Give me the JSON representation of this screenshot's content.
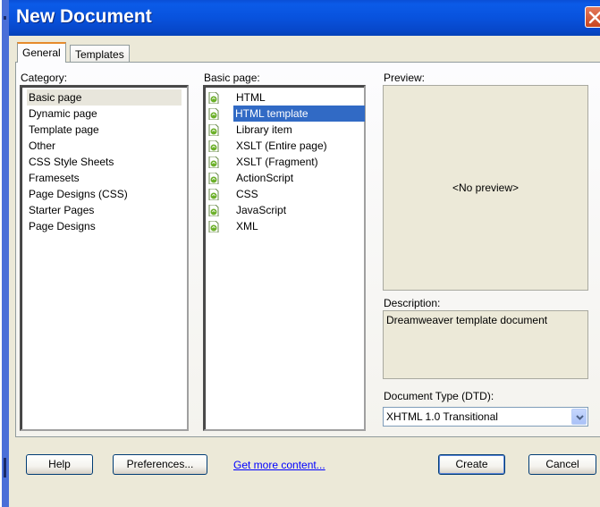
{
  "window": {
    "title": "New Document"
  },
  "tabs": [
    {
      "label": "General",
      "active": true
    },
    {
      "label": "Templates",
      "active": false
    }
  ],
  "category": {
    "label": "Category:",
    "items": [
      "Basic page",
      "Dynamic page",
      "Template page",
      "Other",
      "CSS Style Sheets",
      "Framesets",
      "Page Designs (CSS)",
      "Starter Pages",
      "Page Designs"
    ],
    "selected": "Basic page"
  },
  "basic_page": {
    "label": "Basic page:",
    "items": [
      "HTML",
      "HTML template",
      "Library item",
      "XSLT (Entire page)",
      "XSLT (Fragment)",
      "ActionScript",
      "CSS",
      "JavaScript",
      "XML"
    ],
    "selected": "HTML template",
    "icon": "dreamweaver-file-icon"
  },
  "preview": {
    "label": "Preview:",
    "placeholder": "<No preview>"
  },
  "description": {
    "label": "Description:",
    "text": "Dreamweaver template document"
  },
  "doctype": {
    "label": "Document Type (DTD):",
    "value": "XHTML 1.0 Transitional"
  },
  "buttons": {
    "help": "Help",
    "preferences": "Preferences...",
    "get_more": "Get more content...",
    "create": "Create",
    "cancel": "Cancel"
  },
  "colors": {
    "title_bar": "#0852dd",
    "selection": "#316ac5",
    "dialog_bg": "#ece9d8",
    "link": "#0000ff"
  }
}
